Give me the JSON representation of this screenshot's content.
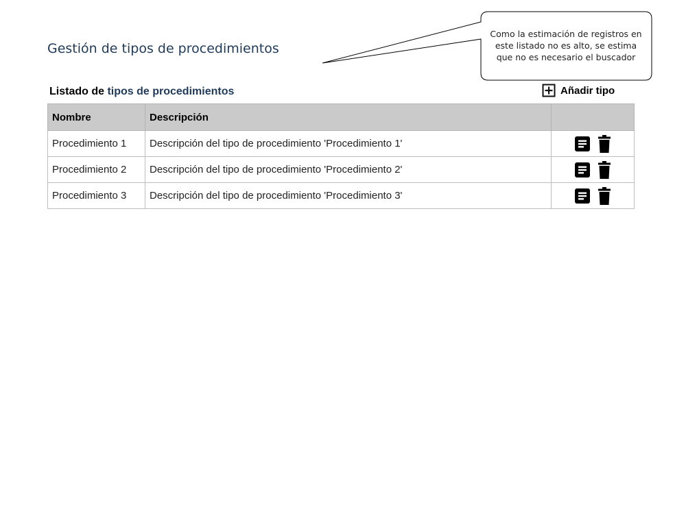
{
  "page": {
    "title": "Gestión de tipos de procedimientos"
  },
  "callout": {
    "line1": "Como la estimación de registros en",
    "line2": "este listado no es alto, se estima",
    "line3": "que no es necesario el buscador"
  },
  "list": {
    "title_prefix": "Listado de ",
    "title_accent": "tipos de procedimientos",
    "add_button_label": "Añadir tipo",
    "columns": {
      "nombre": "Nombre",
      "descripcion": "Descripción",
      "acciones": ""
    },
    "rows": [
      {
        "nombre": "Procedimiento 1",
        "descripcion": "Descripción del tipo de procedimiento 'Procedimiento 1'"
      },
      {
        "nombre": "Procedimiento 2",
        "descripcion": "Descripción del tipo de procedimiento 'Procedimiento 2'"
      },
      {
        "nombre": "Procedimiento 3",
        "descripcion": "Descripción del tipo de procedimiento 'Procedimiento 3'"
      }
    ]
  },
  "icons": {
    "add": "plus-square-icon",
    "edit": "document-icon",
    "delete": "trash-icon"
  },
  "colors": {
    "title": "#1f3a5a",
    "header_bg": "#cacaca",
    "border": "#bdbdbd"
  }
}
